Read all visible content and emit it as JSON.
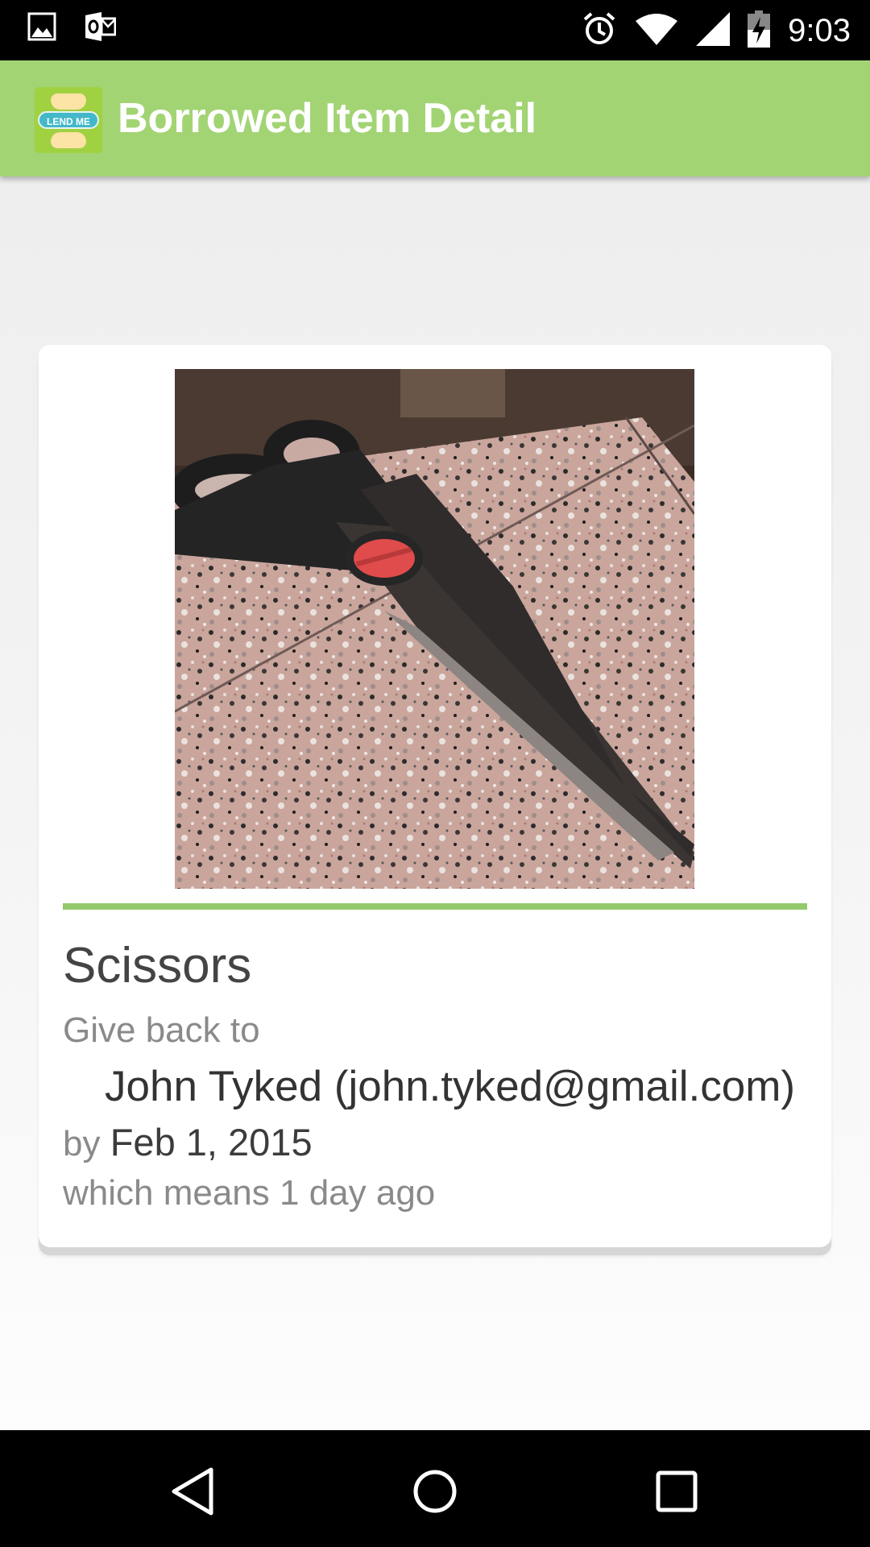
{
  "status_bar": {
    "time": "9:03",
    "notification_icons": [
      "image-icon",
      "outlook-icon"
    ],
    "system_icons": [
      "alarm-icon",
      "wifi-icon",
      "signal-icon",
      "battery-charging-icon"
    ]
  },
  "action_bar": {
    "title": "Borrowed Item Detail",
    "logo_text": "LEND ME",
    "color": "#a2d474"
  },
  "item": {
    "name": "Scissors",
    "give_back_label": "Give back to",
    "borrower": "John Tyked (john.tyked@gmail.com)",
    "by_label": "by",
    "due_date": "Feb 1, 2015",
    "relative_due": "which means 1 day ago",
    "accent_color": "#93c96b"
  },
  "nav_bar": {
    "buttons": [
      "back-icon",
      "home-icon",
      "recents-icon"
    ]
  }
}
